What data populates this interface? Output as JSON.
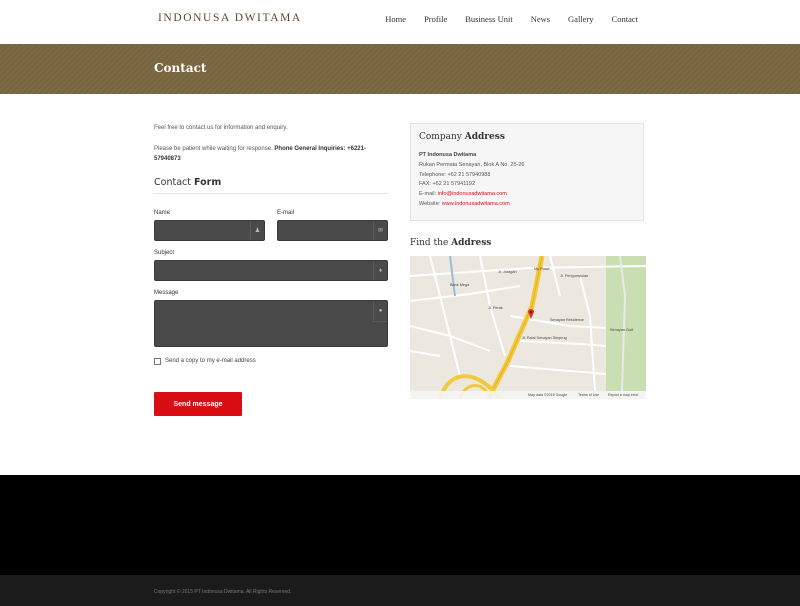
{
  "brand": {
    "logo_text": "INDONUSA DWITAMA"
  },
  "nav": {
    "items": [
      "Home",
      "Profile",
      "Business Unit",
      "News",
      "Gallery",
      "Contact"
    ]
  },
  "banner": {
    "title": "Contact"
  },
  "intro": {
    "line1": "Feel free to contact us for information and enquiry.",
    "line2_prefix": "Please be patient while waiting for response.",
    "line2_bold": "Phone General Inquiries: +6221-57940873"
  },
  "form": {
    "title_regular": "Contact",
    "title_bold": "Form",
    "name_label": "Name",
    "email_label": "E-mail",
    "subject_label": "Subject",
    "message_label": "Message",
    "copy_label": "Send a copy to my e-mail address",
    "submit_label": "Send message"
  },
  "address": {
    "title_regular": "Company",
    "title_bold": "Address",
    "company": "PT Indonusa Dwitama",
    "street": "Rukan Permata Senayan, Blok A No. 25-26",
    "telephone": "Telephone: +62 21 57940988",
    "fax": "FAX: +62 21 57941192",
    "email_prefix": "E-mail: ",
    "email": "info@indonusadwitama.com",
    "website_prefix": "Website: ",
    "website": "www.indonusadwitama.com"
  },
  "find": {
    "title_regular": "Find the",
    "title_bold": "Address"
  },
  "map": {
    "labels": [
      "Jl. Juragan",
      "My Place",
      "Jl. Pengumpulan",
      "Bank Mega",
      "Jl. Perak",
      "Senayan Residence",
      "Jl. Patal Senayan Simprug",
      "Senayan Golf"
    ],
    "footer_data": "Map data ©2015 Google",
    "footer_terms": "Terms of Use",
    "footer_report": "Report a map error"
  },
  "footer": {
    "copyright": "Copyright © 2015 PT Indonusa Dwitama. All Rights Reserved."
  },
  "colors": {
    "banner": "#7b6843",
    "accent": "#d90d13",
    "field": "#4a4a4a"
  }
}
